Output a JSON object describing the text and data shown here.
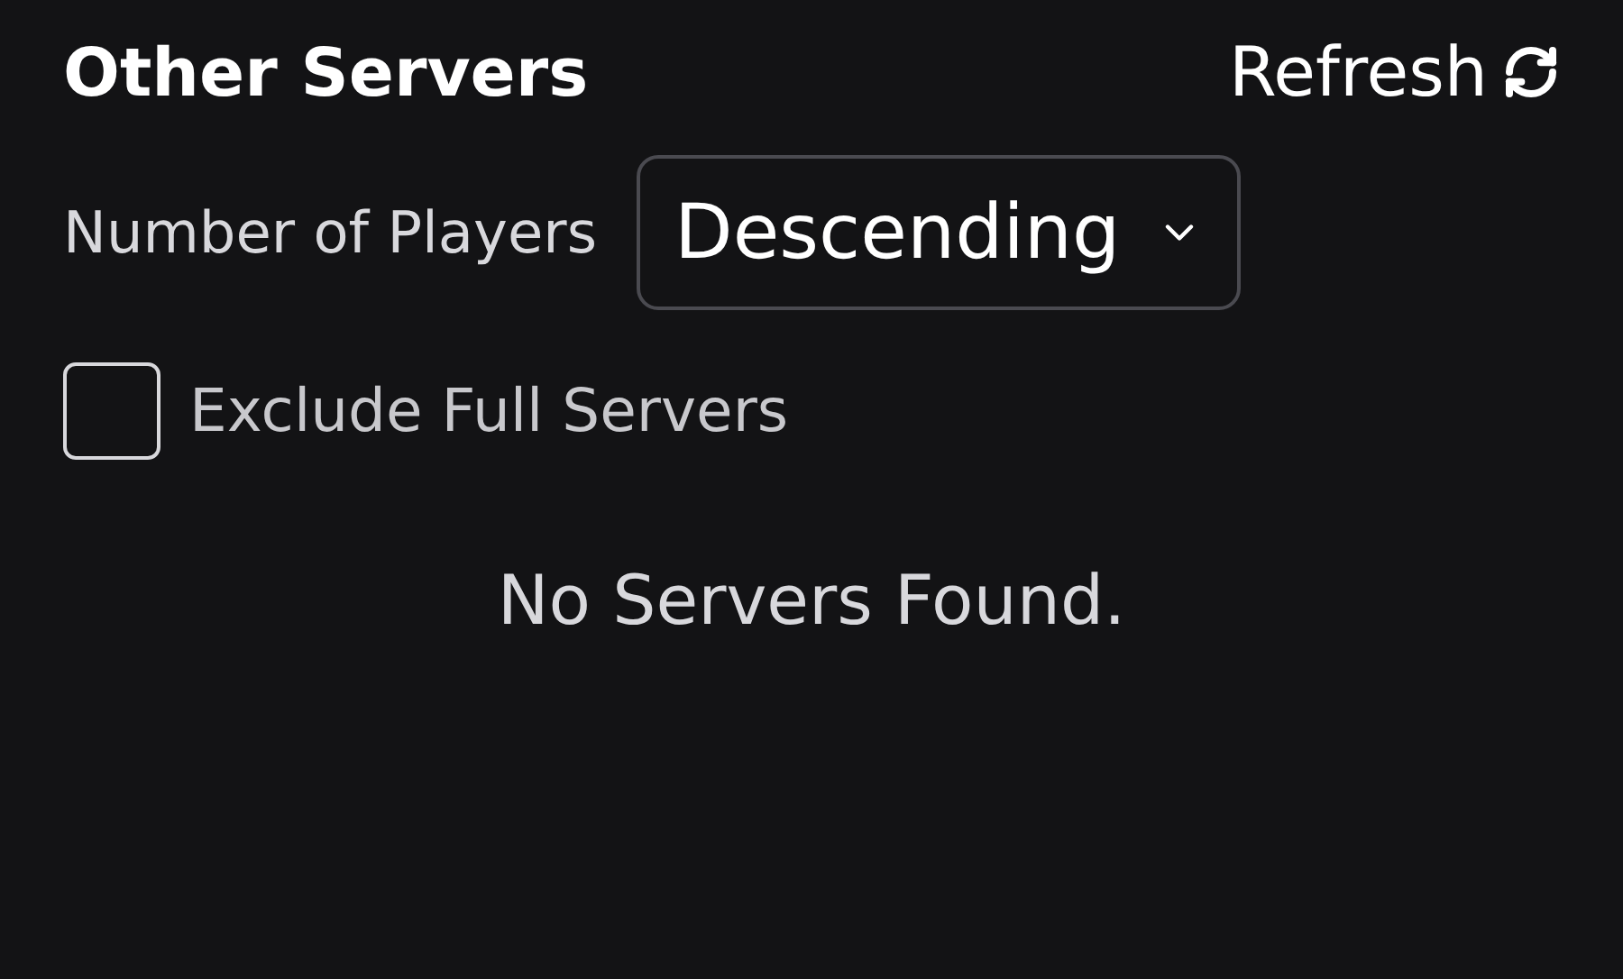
{
  "header": {
    "title": "Other Servers",
    "refresh_label": "Refresh"
  },
  "sort": {
    "label": "Number of Players",
    "value": "Descending"
  },
  "filter": {
    "label": "Exclude Full Servers",
    "checked": false
  },
  "empty_message": "No Servers Found."
}
